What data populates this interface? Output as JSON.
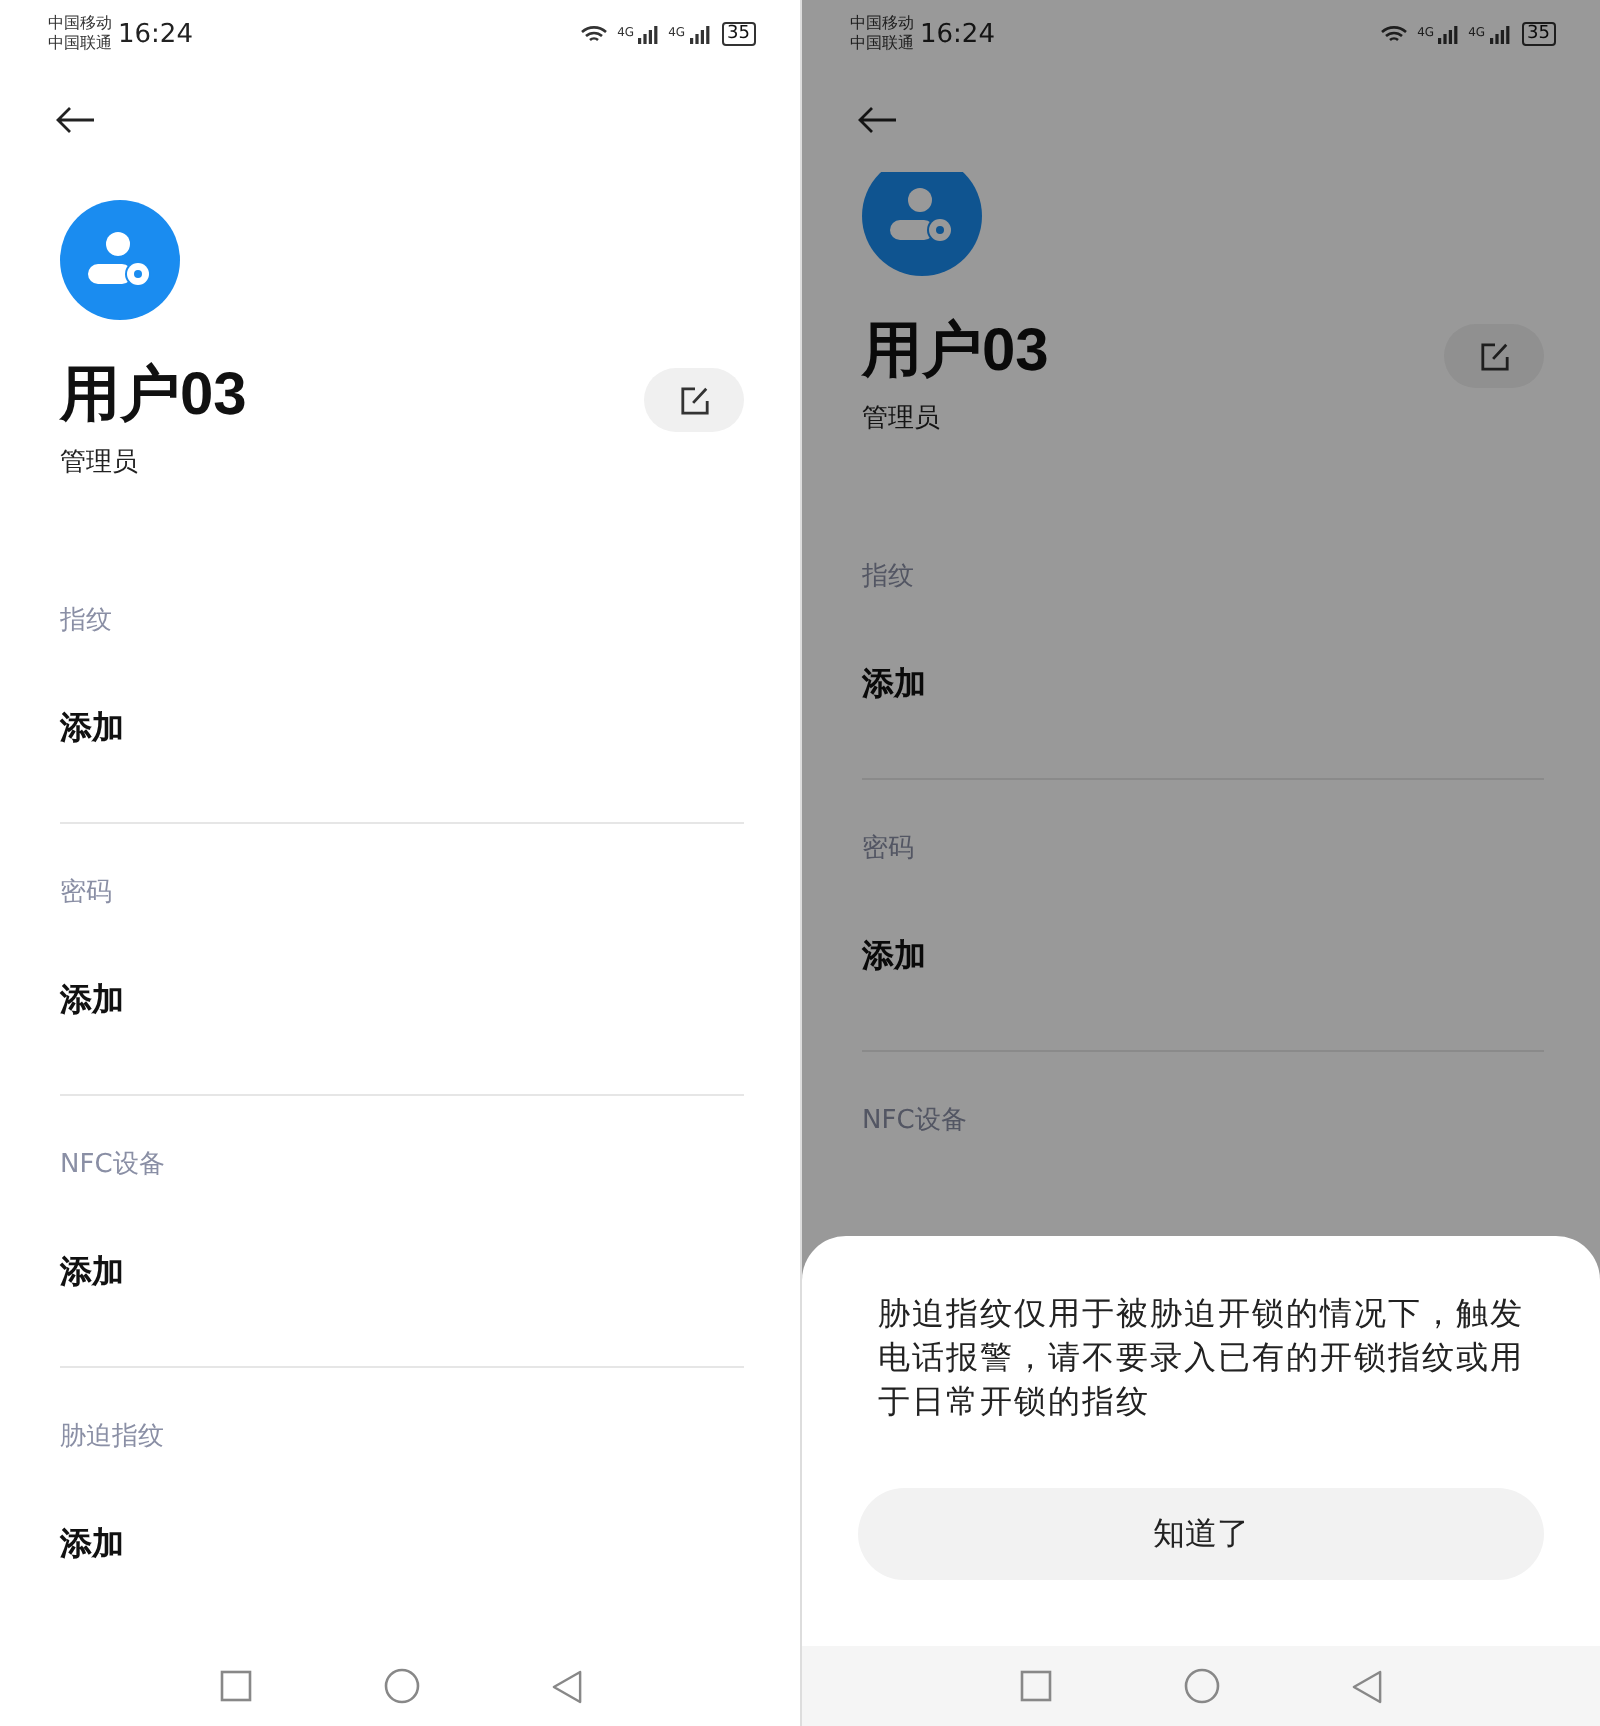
{
  "screens": [
    {
      "status_bar": {
        "carriers": [
          "中国移动",
          "中国联通"
        ],
        "time": "16:24",
        "networks": [
          "4G",
          "4G"
        ],
        "battery": "35"
      },
      "dimmed": false,
      "user": {
        "name": "用户03",
        "role": "管理员"
      },
      "sections": [
        {
          "label": "指纹",
          "action": "添加"
        },
        {
          "label": "密码",
          "action": "添加"
        },
        {
          "label": "NFC设备",
          "action": "添加"
        },
        {
          "label": "胁迫指纹",
          "action": "添加"
        }
      ]
    },
    {
      "status_bar": {
        "carriers": [
          "中国移动",
          "中国联通"
        ],
        "time": "16:24",
        "networks": [
          "4G",
          "4G"
        ],
        "battery": "35"
      },
      "dimmed": true,
      "user": {
        "name": "用户03",
        "role": "管理员"
      },
      "sections": [
        {
          "label": "指纹",
          "action": "添加"
        },
        {
          "label": "密码",
          "action": "添加"
        },
        {
          "label": "NFC设备"
        }
      ],
      "sheet": {
        "message": "胁迫指纹仅用于被胁迫开锁的情况下，触发电话报警，请不要录入已有的开锁指纹或用于日常开锁的指纹",
        "button": "知道了"
      }
    }
  ]
}
